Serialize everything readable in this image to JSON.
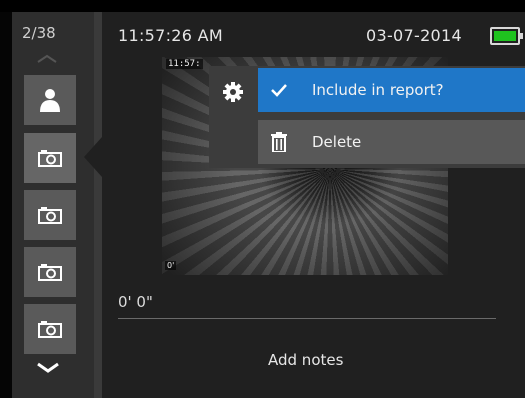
{
  "status": {
    "counter": "2/38",
    "time": "11:57:26 AM",
    "date": "03-07-2014",
    "battery_icon": "battery-full-icon",
    "battery_color": "#1fc21f",
    "battery_level": 1.0
  },
  "sidebar": {
    "scroll_up_icon": "chevron-up-icon",
    "scroll_down_icon": "chevron-down-icon",
    "items": [
      {
        "icon": "person-icon",
        "selected": false
      },
      {
        "icon": "camera-icon",
        "selected": true
      },
      {
        "icon": "camera-icon",
        "selected": false
      },
      {
        "icon": "camera-icon",
        "selected": false
      },
      {
        "icon": "camera-icon",
        "selected": false
      }
    ]
  },
  "photo": {
    "overlay_time": "11:57:",
    "overlay_distance": "0'"
  },
  "distance": "0' 0\"",
  "notes_label": "Add notes",
  "menu": {
    "settings_icon": "gear-icon",
    "items": [
      {
        "label": "Include in report?",
        "icon": "checkmark-icon",
        "active": true
      },
      {
        "label": "Delete",
        "icon": "trash-icon",
        "active": false
      }
    ],
    "accent": "#1f77c8"
  }
}
